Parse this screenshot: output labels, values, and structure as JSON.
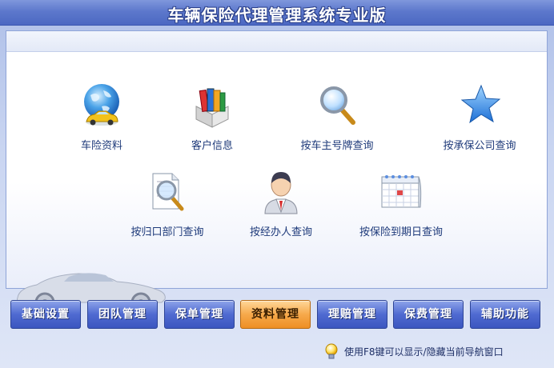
{
  "window": {
    "title": "车辆保险代理管理系统专业版"
  },
  "panel": {
    "items": [
      {
        "label": "车险资料",
        "icon": "globe-car-icon"
      },
      {
        "label": "客户信息",
        "icon": "books-icon"
      },
      {
        "label": "按车主号牌查询",
        "icon": "magnifier-icon"
      },
      {
        "label": "按承保公司查询",
        "icon": "star-icon"
      },
      {
        "label": "按归口部门查询",
        "icon": "document-search-icon"
      },
      {
        "label": "按经办人查询",
        "icon": "person-icon"
      },
      {
        "label": "按保险到期日查询",
        "icon": "calendar-icon"
      }
    ]
  },
  "nav": {
    "buttons": [
      {
        "label": "基础设置"
      },
      {
        "label": "团队管理"
      },
      {
        "label": "保单管理"
      },
      {
        "label": "资料管理",
        "active": true
      },
      {
        "label": "理赔管理"
      },
      {
        "label": "保费管理"
      },
      {
        "label": "辅助功能"
      }
    ]
  },
  "hint": {
    "text": "使用F8键可以显示/隐藏当前导航窗口"
  },
  "colors": {
    "accent": "#4f6ad1",
    "active": "#f6a94b",
    "label": "#1e3a7a"
  }
}
